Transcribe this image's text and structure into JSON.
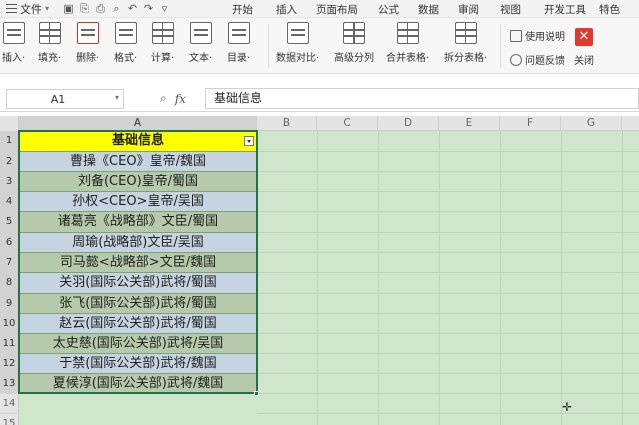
{
  "menu": {
    "file_label": "文件",
    "tabs": [
      "开始",
      "插入",
      "页面布局",
      "公式",
      "数据",
      "审阅",
      "视图",
      "开发工具",
      "特色"
    ]
  },
  "ribbon": {
    "buttons": [
      "插入·",
      "填充·",
      "删除·",
      "格式·",
      "计算·",
      "文本·",
      "目录·",
      "数据对比·",
      "高级分列",
      "合并表格·",
      "拆分表格·"
    ],
    "help_label": "使用说明",
    "feedback_label": "问题反馈",
    "close_label": "关闭",
    "close_glyph": "✕"
  },
  "formula_bar": {
    "cell_ref": "A1",
    "fx_label": "fx",
    "formula_value": "基础信息"
  },
  "sheet": {
    "columns": [
      "A",
      "B",
      "C",
      "D",
      "E",
      "F",
      "G"
    ],
    "rows": [
      "1",
      "2",
      "3",
      "4",
      "5",
      "6",
      "7",
      "8",
      "9",
      "10",
      "11",
      "12",
      "13",
      "14",
      "15"
    ],
    "header_cell": "基础信息",
    "cells": [
      "曹操《CEO》皇帝/魏国",
      "刘备(CEO)皇帝/蜀国",
      "孙权<CEO>皇帝/吴国",
      "诸葛亮《战略部》文臣/蜀国",
      "周瑜(战略部)文臣/吴国",
      "司马懿<战略部>文臣/魏国",
      "关羽(国际公关部)武将/蜀国",
      "张飞(国际公关部)武将/蜀国",
      "赵云(国际公关部)武将/蜀国",
      "太史慈(国际公关部)武将/吴国",
      "于禁(国际公关部)武将/魏国",
      "夏候淳(国际公关部)武将/魏国"
    ],
    "colors": {
      "header_fill": "#ffff00",
      "row_blue": "#c6d3e0",
      "row_green": "#b6c9ab",
      "sheet_bg": "#cfe6cd",
      "selection": "#217346"
    }
  }
}
